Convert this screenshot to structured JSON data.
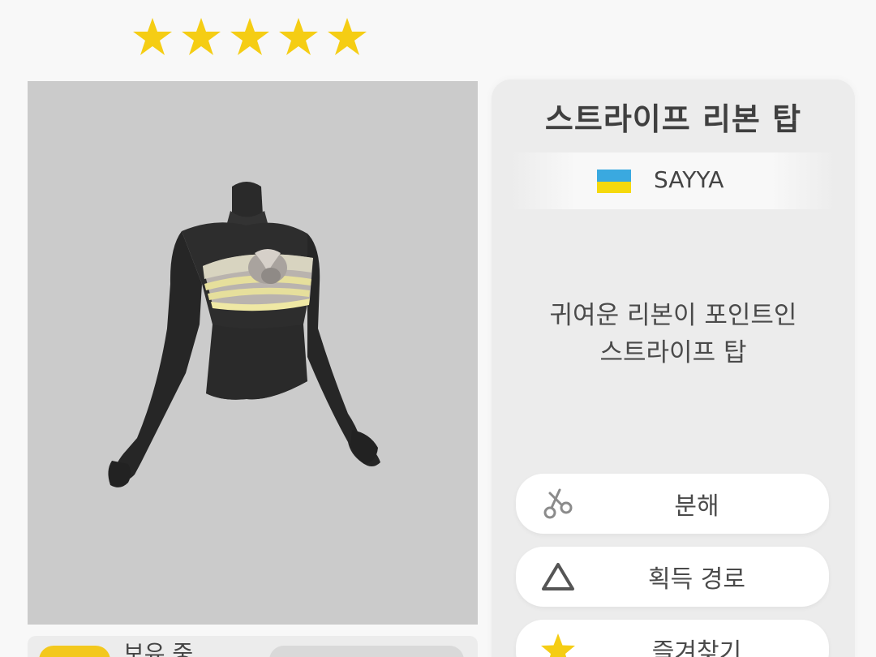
{
  "rarity": {
    "stars": 5,
    "max_stars": 5,
    "color": "#f5cd14"
  },
  "item": {
    "name": "스트라이프 리본 탑",
    "brand": "SAYYA",
    "description_line1": "귀여운 리본이 포인트인",
    "description_line2": "스트라이프 탑"
  },
  "actions": {
    "disassemble_label": "분해",
    "route_label": "획득 경로",
    "favorite_label": "즐겨찾기"
  },
  "owned": {
    "label": "보유 중"
  },
  "icons": {
    "disassemble": "scissors-icon",
    "route": "triangle-icon",
    "favorite": "star-icon",
    "brand": "ukraine-flag-icon"
  },
  "colors": {
    "star": "#f5cd14",
    "preview_bg": "#cbcbcb",
    "flag_blue": "#3aa9e0",
    "flag_yellow": "#f5d90d"
  }
}
